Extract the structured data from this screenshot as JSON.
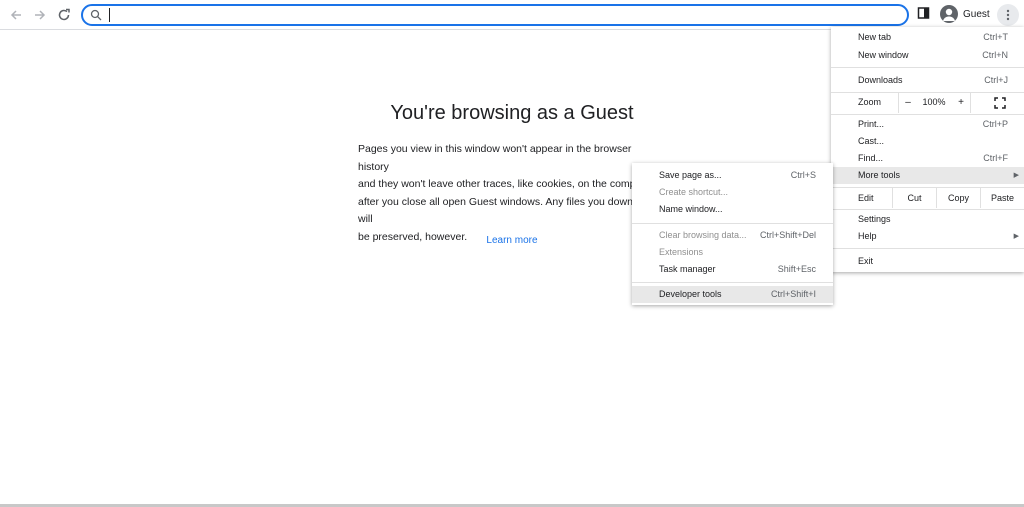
{
  "toolbar": {
    "back_icon": "arrow-left-icon",
    "forward_icon": "arrow-right-icon",
    "reload_icon": "reload-icon",
    "search_icon": "search-icon",
    "omnibox_value": "",
    "side_panel_icon": "side-panel-icon",
    "avatar_icon": "person-icon",
    "profile_label": "Guest",
    "menu_icon": "three-dots-vertical-icon",
    "accent": "#1a73e8"
  },
  "content": {
    "title": "You're browsing as a Guest",
    "body": "Pages you view in this window won't appear in the browser history\nand they won't leave other traces, like cookies, on the computer\nafter you close all open Guest windows. Any files you download will\nbe preserved, however.",
    "learn_more": "Learn more"
  },
  "main_menu": {
    "new_tab": {
      "label": "New tab",
      "shortcut": "Ctrl+T"
    },
    "new_window": {
      "label": "New window",
      "shortcut": "Ctrl+N"
    },
    "downloads": {
      "label": "Downloads",
      "shortcut": "Ctrl+J"
    },
    "zoom": {
      "label": "Zoom",
      "minus": "–",
      "value": "100%",
      "plus": "+",
      "fullscreen_icon": "fullscreen-icon"
    },
    "print": {
      "label": "Print...",
      "shortcut": "Ctrl+P"
    },
    "cast": {
      "label": "Cast..."
    },
    "find": {
      "label": "Find...",
      "shortcut": "Ctrl+F"
    },
    "more_tools": {
      "label": "More tools",
      "arrow": "▶"
    },
    "edit": {
      "label": "Edit",
      "cut": "Cut",
      "copy": "Copy",
      "paste": "Paste"
    },
    "settings": {
      "label": "Settings"
    },
    "help": {
      "label": "Help",
      "arrow": "▶"
    },
    "exit": {
      "label": "Exit"
    }
  },
  "more_tools_menu": {
    "save_page": {
      "label": "Save page as...",
      "shortcut": "Ctrl+S"
    },
    "create_shortcut": {
      "label": "Create shortcut..."
    },
    "name_window": {
      "label": "Name window..."
    },
    "clear_browsing": {
      "label": "Clear browsing data...",
      "shortcut": "Ctrl+Shift+Del"
    },
    "extensions": {
      "label": "Extensions"
    },
    "task_manager": {
      "label": "Task manager",
      "shortcut": "Shift+Esc"
    },
    "developer_tools": {
      "label": "Developer tools",
      "shortcut": "Ctrl+Shift+I"
    }
  }
}
